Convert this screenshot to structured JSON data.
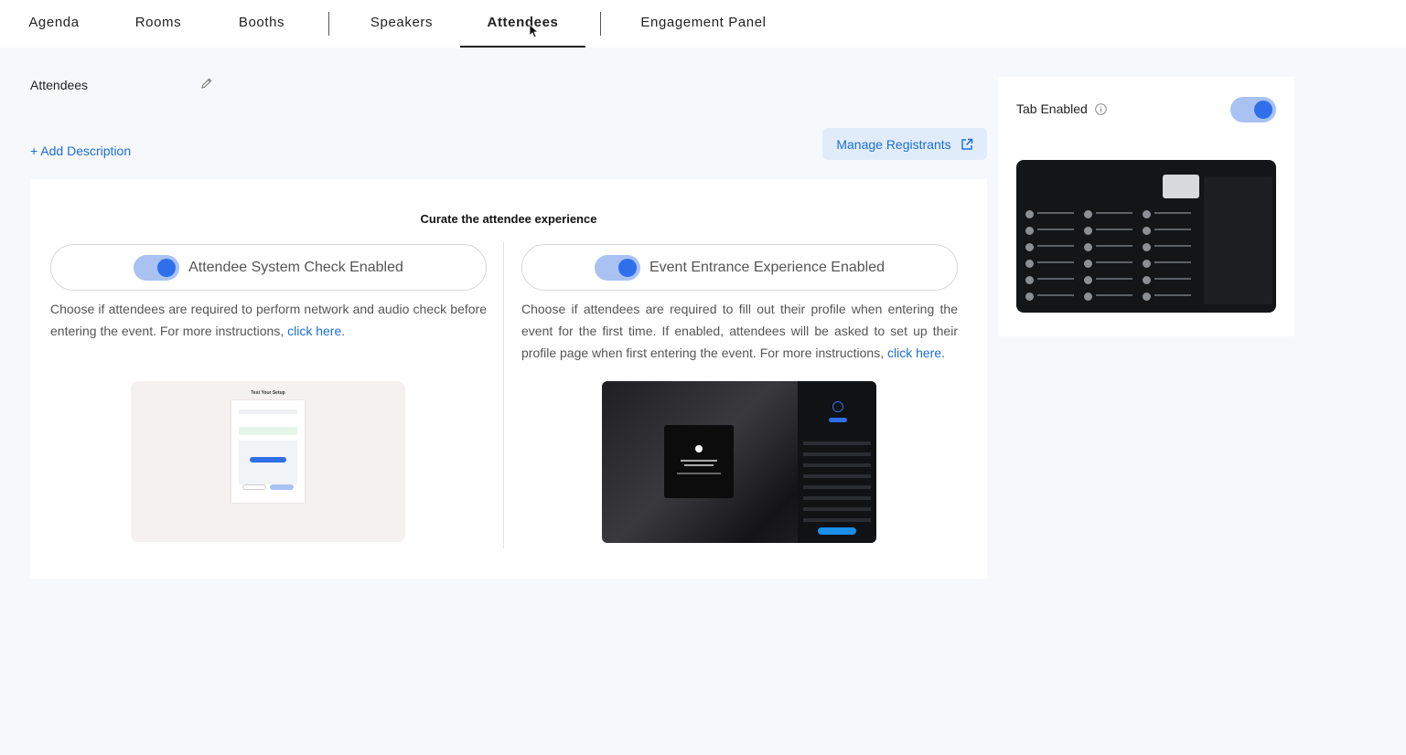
{
  "tabs": [
    {
      "label": "Agenda"
    },
    {
      "label": "Rooms"
    },
    {
      "label": "Booths"
    },
    {
      "label": "Speakers"
    },
    {
      "label": "Attendees",
      "active": true
    },
    {
      "label": "Engagement Panel"
    }
  ],
  "page": {
    "title": "Attendees",
    "add_description": "+ Add Description",
    "manage_registrants": "Manage Registrants"
  },
  "card": {
    "title": "Curate the attendee experience",
    "system_check": {
      "label": "Attendee System Check Enabled",
      "enabled": true,
      "description": "Choose if attendees are required to perform network and audio check before entering the event. For more instructions, ",
      "link": "click here",
      "suffix": "."
    },
    "entrance": {
      "label": "Event Entrance Experience Enabled",
      "enabled": true,
      "description": "Choose if attendees are required to fill out their profile when entering the event for the first time. If enabled, attendees will be asked to set up their profile page when first entering the event. For more instructions, ",
      "link": "click here",
      "suffix": "."
    },
    "preview_setup_title": "Test Your Setup"
  },
  "side": {
    "tab_enabled_label": "Tab Enabled",
    "tab_enabled": true
  },
  "colors": {
    "accent": "#1a6fd8",
    "toggle_on": "#2f6fea",
    "toggle_track": "#a9c2f2"
  }
}
